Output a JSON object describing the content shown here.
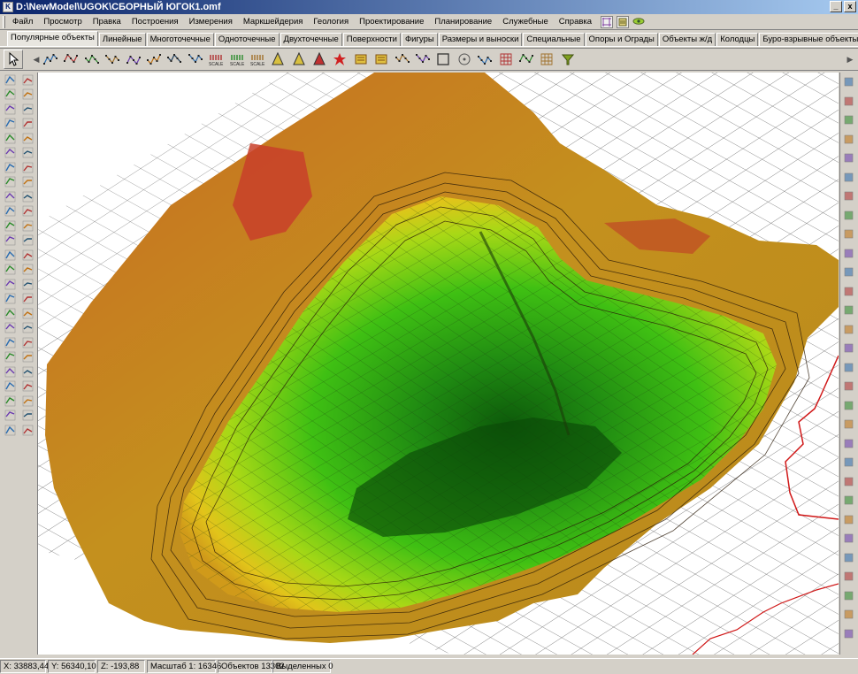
{
  "window": {
    "title": "D:\\NewModel\\UGOK\\СБОРНЫЙ ЮГОК1.omf",
    "minimize": "_",
    "close": "x"
  },
  "menu": {
    "items": [
      "Файл",
      "Просмотр",
      "Правка",
      "Построения",
      "Измерения",
      "Маркшейдерия",
      "Геология",
      "Проектирование",
      "Планирование",
      "Служебные",
      "Справка"
    ]
  },
  "tabs": {
    "items": [
      "Популярные объекты",
      "Линейные",
      "Многоточечные",
      "Одноточечные",
      "Двухточечные",
      "Поверхности",
      "Фигуры",
      "Размеры и выноски",
      "Специальные",
      "Опоры и Ограды",
      "Объекты ж/д",
      "Колодцы",
      "Буро-взрывные объекты"
    ],
    "active_index": 0
  },
  "toolbar": {
    "buttons": [
      "select-arrow-icon",
      "polyline-icon",
      "spline-icon",
      "contour-line-icon",
      "multi-point-line-icon",
      "point-cloud-icon",
      "scatter-points-icon",
      "segment-icon",
      "arrow-line-icon",
      "scale-bar-icon",
      "scale-bar-red-icon",
      "scale-bar-green-icon",
      "north-arrow-icon",
      "text-label-icon",
      "text-label-red-icon",
      "star-symbol-icon",
      "number-symbol-icon",
      "block-icon",
      "crossed-figure-icon",
      "dimension-icon",
      "frame-icon",
      "circle-target-icon",
      "curve-node-icon",
      "grid-icon",
      "support-icon",
      "mesh-icon",
      "funnel-icon"
    ],
    "scale_label": "SCALE"
  },
  "status": {
    "x": "X: 33883,44",
    "y": "Y: 56340,10",
    "z": "Z: -193,88",
    "scale": "Масштаб 1: 16346",
    "objects": "Объектов 13302",
    "selected": "Выделенных 0"
  },
  "colors": {
    "rim_top": "#c8602a",
    "rim": "#c08a1c",
    "bench": "#d8b21a",
    "slope": "#b8d818",
    "pit": "#40c010",
    "pit_deep": "#0a5a08",
    "profile_line": "#d01818",
    "grid_line": "#505050"
  }
}
